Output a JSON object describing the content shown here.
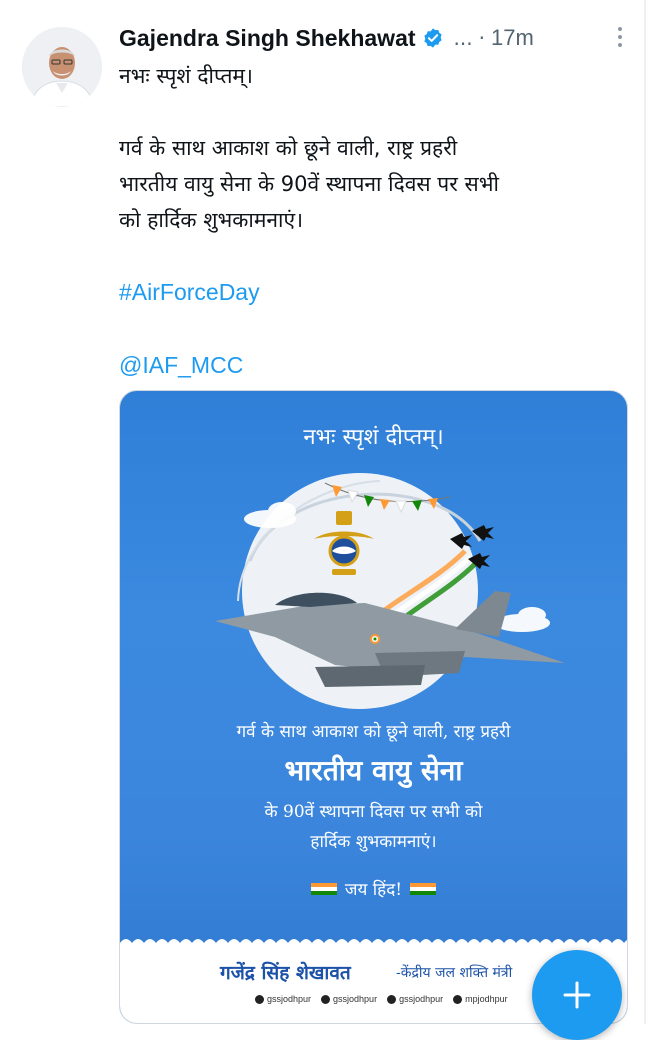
{
  "tweet": {
    "author_name": "Gajendra Singh Shekhawat",
    "handle_truncated": "...",
    "separator": "·",
    "time": "17m",
    "text_line1": "नभः स्पृशं दीप्तम्।",
    "text_para2_line1": "गर्व के साथ आकाश को छूने वाली, राष्ट्र प्रहरी",
    "text_para2_line2": "भारतीय वायु सेना के 90वें स्थापना दिवस पर सभी",
    "text_para2_line3": "को हार्दिक शुभकामनाएं।",
    "hashtag": "#AirForceDay",
    "mention": "@IAF_MCC"
  },
  "poster": {
    "title": "नभः स्पृशं दीप्तम्।",
    "line1": "गर्व के साथ आकाश को छूने वाली, राष्ट्र प्रहरी",
    "line2": "भारतीय वायु सेना",
    "line3": "के 90वें स्थापना दिवस पर सभी को",
    "line4": "हार्दिक शुभकामनाएं।",
    "jai_hind": "जय हिंद!",
    "footer_name": "गजेंद्र सिंह शेखावत",
    "footer_role": "-केंद्रीय जल शक्ति मंत्री",
    "socials": [
      "gssjodhpur",
      "gssjodhpur",
      "gssjodhpur",
      "mpjodhpur"
    ]
  },
  "colors": {
    "link": "#1d9bf0",
    "verified": "#1d9bf0",
    "saffron": "#ff9933",
    "green": "#138808"
  },
  "icons": {
    "verified": "verified-badge-icon",
    "more": "more-vertical-icon",
    "fab": "plus-icon"
  }
}
